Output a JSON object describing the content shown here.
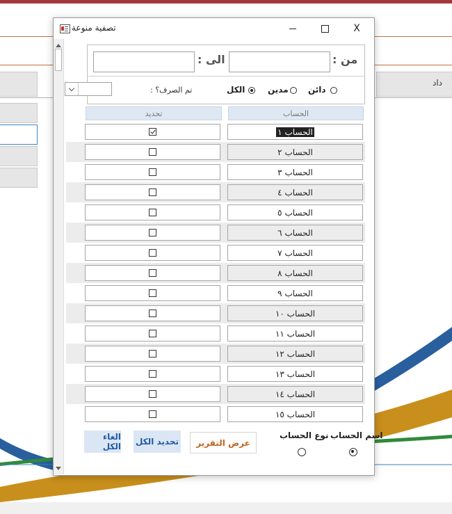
{
  "background": {
    "left_label": "داد"
  },
  "dialog": {
    "title": "تصفية منوعة",
    "close_symbol": "X",
    "filter": {
      "from_label": "من :",
      "to_label": "الى :",
      "radio_all": "الكل",
      "radio_debit": "مدين",
      "radio_credit": "دائن",
      "selected_radio": "الكل",
      "paid_label": "تم الصرف؟ :"
    },
    "columns": {
      "account": "الحساب",
      "select": "تحديد"
    },
    "rows": [
      {
        "account": "الحساب ١",
        "checked": true
      },
      {
        "account": "الحساب ٢",
        "checked": false
      },
      {
        "account": "الحساب ٣",
        "checked": false
      },
      {
        "account": "الحساب ٤",
        "checked": false
      },
      {
        "account": "الحساب ٥",
        "checked": false
      },
      {
        "account": "الحساب ٦",
        "checked": false
      },
      {
        "account": "الحساب ٧",
        "checked": false
      },
      {
        "account": "الحساب ٨",
        "checked": false
      },
      {
        "account": "الحساب ٩",
        "checked": false
      },
      {
        "account": "الحساب ١٠",
        "checked": false
      },
      {
        "account": "الحساب ١١",
        "checked": false
      },
      {
        "account": "الحساب ١٢",
        "checked": false
      },
      {
        "account": "الحساب ١٣",
        "checked": false
      },
      {
        "account": "الحساب ١٤",
        "checked": false
      },
      {
        "account": "الحساب ١٥",
        "checked": false
      }
    ],
    "buttons": {
      "cancel_all": "الغاء الكل",
      "select_all": "تحديد الكل",
      "show_report": "عرض التقرير"
    },
    "report_options": {
      "account_name": "اسم الحساب",
      "account_type": "نوع الحساب",
      "selected": "اسم الحساب"
    }
  },
  "colors": {
    "topbar": "#a4373a",
    "header_bg": "#dde8f3",
    "button_blue_text": "#1f5aa6",
    "report_text": "#c0641e"
  }
}
